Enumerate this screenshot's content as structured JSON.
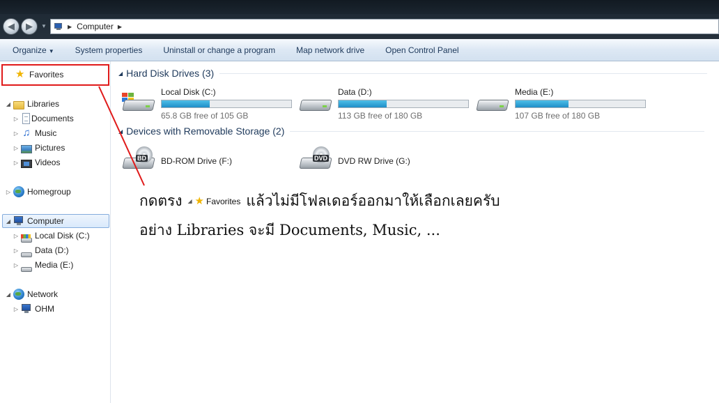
{
  "address": {
    "path": "Computer"
  },
  "toolbar": {
    "organize": "Organize",
    "system_properties": "System properties",
    "uninstall": "Uninstall or change a program",
    "map_drive": "Map network drive",
    "control_panel": "Open Control Panel"
  },
  "nav": {
    "favorites": "Favorites",
    "libraries": "Libraries",
    "documents": "Documents",
    "music": "Music",
    "pictures": "Pictures",
    "videos": "Videos",
    "homegroup": "Homegroup",
    "computer": "Computer",
    "local_disk": "Local Disk (C:)",
    "data": "Data (D:)",
    "media": "Media (E:)",
    "network": "Network",
    "ohm": "OHM"
  },
  "groups": {
    "hdd": "Hard Disk Drives (3)",
    "removable": "Devices with Removable Storage (2)"
  },
  "drives": [
    {
      "name": "Local Disk (C:)",
      "free": "65.8 GB free of 105 GB",
      "used_fraction": 0.373
    },
    {
      "name": "Data (D:)",
      "free": "113 GB free of 180 GB",
      "used_fraction": 0.372
    },
    {
      "name": "Media (E:)",
      "free": "107 GB free of 180 GB",
      "used_fraction": 0.406
    }
  ],
  "removable": [
    {
      "name": "BD-ROM Drive (F:)",
      "tag": "BD"
    },
    {
      "name": "DVD RW Drive (G:)",
      "tag": "DVD"
    }
  ],
  "annotation": {
    "line1_before": "กดตรง",
    "line1_fav": "Favorites",
    "line1_after": "แล้วไม่มีโฟลเดอร์ออกมาให้เลือกเลยครับ",
    "line2": "อย่าง Libraries จะมี Documents, Music, ...",
    "color": "#e01a1a"
  }
}
